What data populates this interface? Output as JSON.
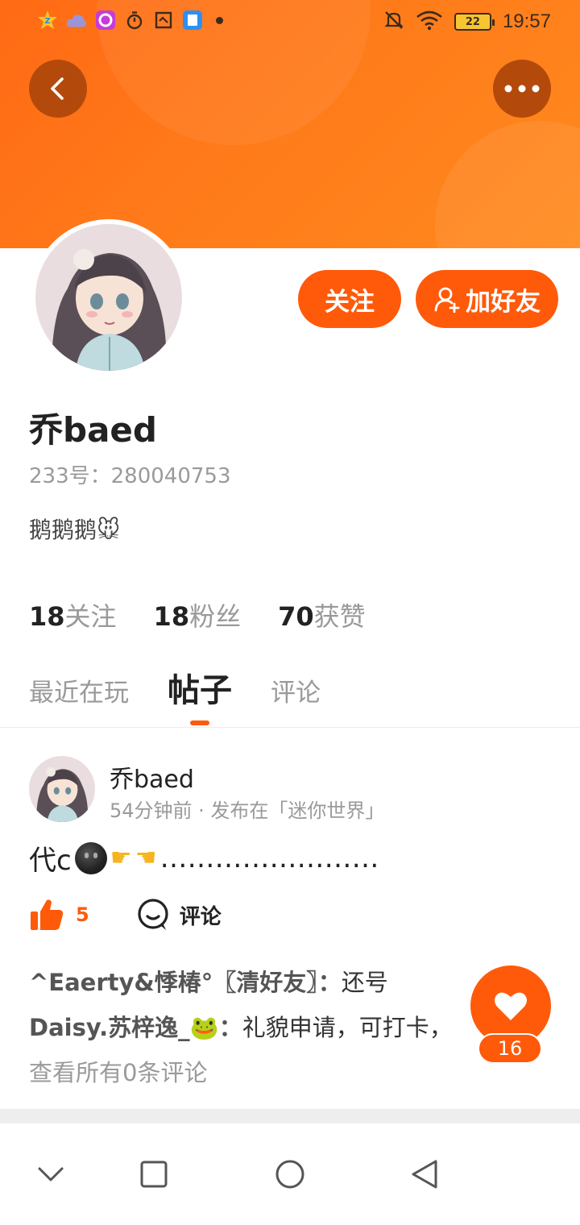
{
  "status_bar": {
    "time": "19:57",
    "battery": "22",
    "left_icons": [
      "app-z-icon",
      "cloud-icon",
      "music-app-icon",
      "timer-icon",
      "screenshot-icon",
      "reader-icon"
    ],
    "right_icons": [
      "mute-icon",
      "wifi-icon",
      "battery-icon"
    ]
  },
  "header": {
    "back_icon": "chevron-left-icon",
    "more_icon": "more-dots-icon"
  },
  "profile": {
    "follow_label": "关注",
    "add_friend_label": "加好友",
    "username": "乔baed",
    "id_text": "233号：280040753",
    "bio": "鹅鹅鹅🐭",
    "stats": [
      {
        "count": "18",
        "label": "关注"
      },
      {
        "count": "18",
        "label": "粉丝"
      },
      {
        "count": "70",
        "label": "获赞"
      }
    ]
  },
  "tabs": [
    {
      "label": "最近在玩",
      "active": false
    },
    {
      "label": "帖子",
      "active": true
    },
    {
      "label": "评论",
      "active": false
    }
  ],
  "post": {
    "author": "乔baed",
    "meta": "54分钟前 · 发布在「迷你世界」",
    "text_prefix": "代c",
    "text_suffix": "……………………",
    "like_count": "5",
    "comment_label": "评论",
    "comments": [
      {
        "user": "^Eaerty&悸椿°〖清好友〗：",
        "text": "还号"
      },
      {
        "user": "Daisy.苏梓逸_🐸：",
        "text": "礼貌申请，可打卡，"
      }
    ],
    "view_all": "查看所有0条评论"
  },
  "fab": {
    "count": "16"
  },
  "colors": {
    "accent": "#ff5a0a",
    "banner": "#ff7a1a"
  }
}
